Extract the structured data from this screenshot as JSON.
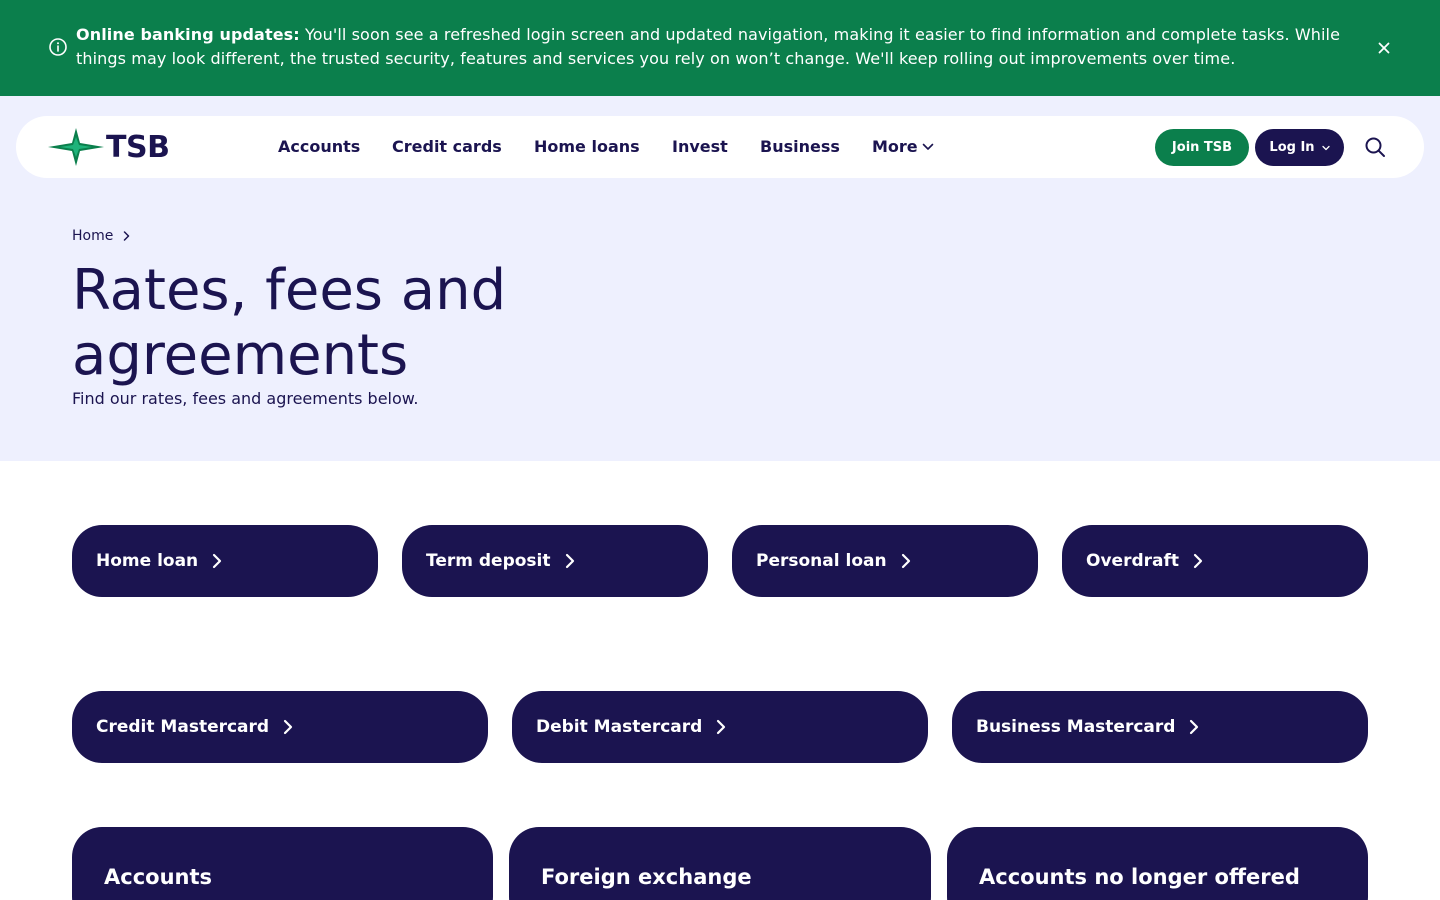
{
  "banner": {
    "title": "Online banking updates:",
    "message": "You'll soon see a refreshed login screen and updated navigation, making it easier to find information and complete tasks. While things may look different, the trusted security, features and services you rely on won’t change. We'll keep rolling out improvements over time.",
    "background_color": "#0b7f4c"
  },
  "header": {
    "logo_text": "TSB",
    "nav": [
      {
        "label": "Accounts"
      },
      {
        "label": "Credit cards"
      },
      {
        "label": "Home loans"
      },
      {
        "label": "Invest"
      },
      {
        "label": "Business"
      },
      {
        "label": "More"
      }
    ],
    "join_label": "Join TSB",
    "login_label": "Log In",
    "brand_color": "#1b1450",
    "accent_color": "#0b7f4c"
  },
  "breadcrumb": {
    "home": "Home"
  },
  "page": {
    "title": "Rates, fees and agreements",
    "subtitle": "Find our rates, fees and agreements below."
  },
  "links_row1": [
    {
      "label": "Home loan"
    },
    {
      "label": "Term deposit"
    },
    {
      "label": "Personal loan"
    },
    {
      "label": "Overdraft"
    }
  ],
  "links_row2": [
    {
      "label": "Credit Mastercard"
    },
    {
      "label": "Debit Mastercard"
    },
    {
      "label": "Business Mastercard"
    }
  ],
  "cards": [
    {
      "title": "Accounts"
    },
    {
      "title": "Foreign exchange"
    },
    {
      "title": "Accounts no longer offered"
    }
  ]
}
